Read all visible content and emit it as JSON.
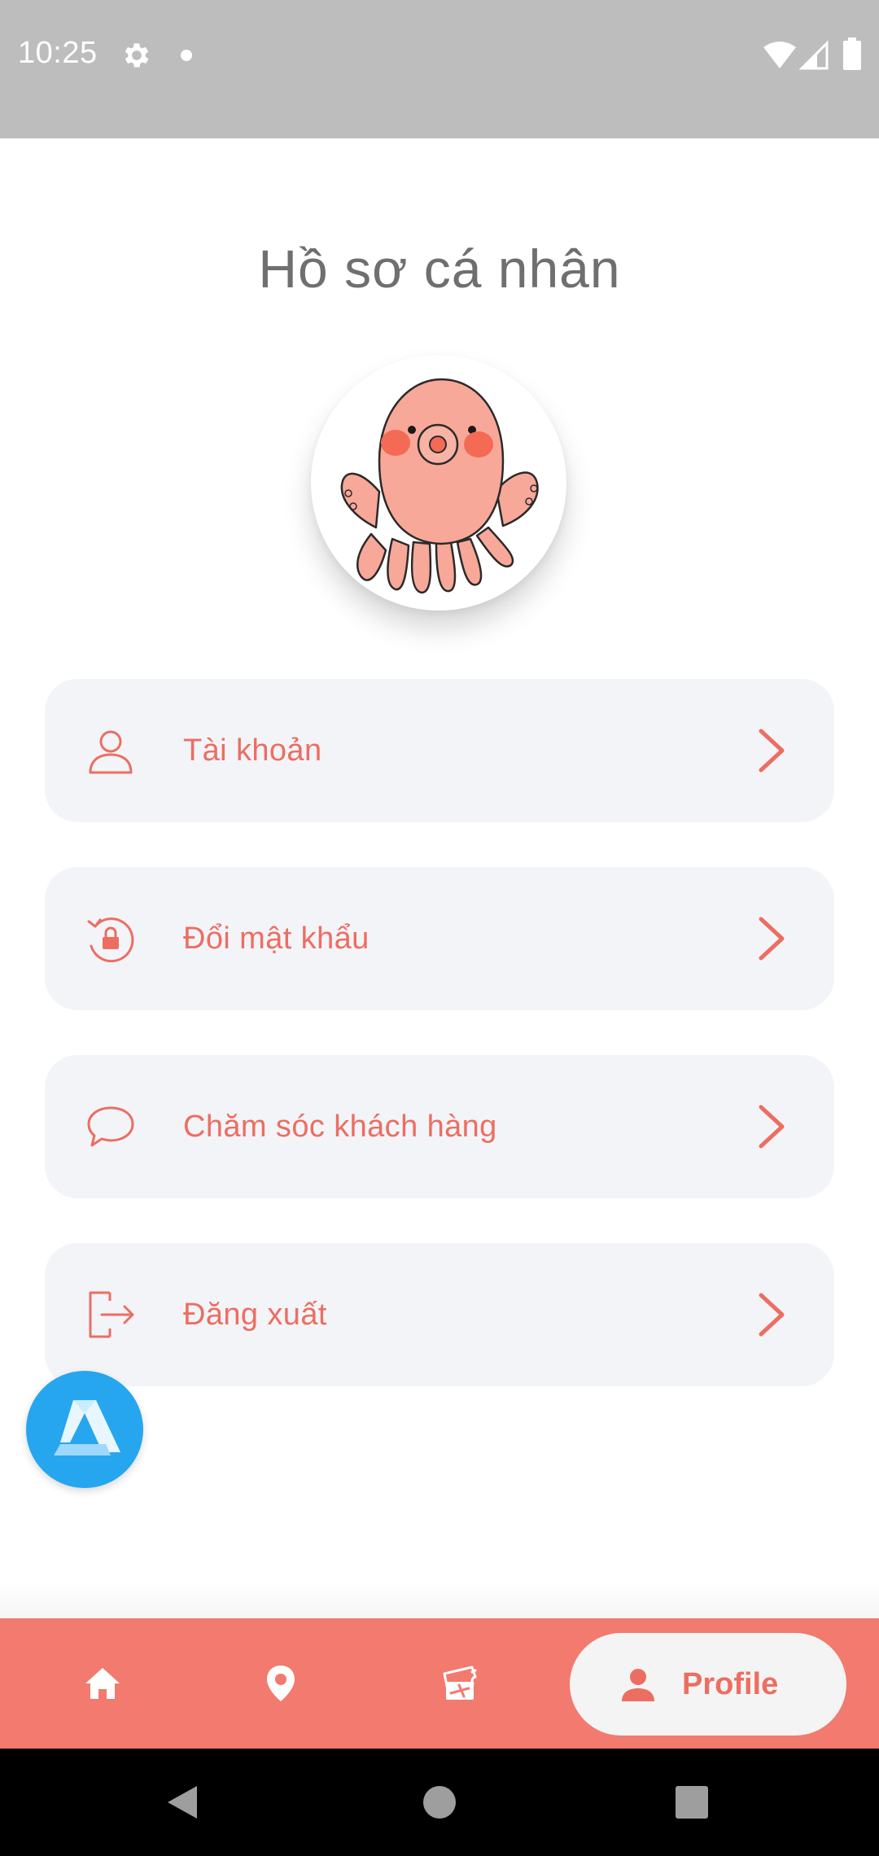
{
  "status_bar": {
    "time": "10:25",
    "icons": [
      "gear-icon",
      "dot-icon",
      "wifi-icon",
      "signal-icon",
      "battery-icon"
    ]
  },
  "page": {
    "title": "Hồ sơ cá nhân"
  },
  "avatar": {
    "icon": "octopus-avatar-icon"
  },
  "menu": {
    "items": [
      {
        "label": "Tài khoản",
        "icon": "user-icon"
      },
      {
        "label": "Đổi mật khẩu",
        "icon": "lock-rotate-icon"
      },
      {
        "label": "Chăm sóc khách hàng",
        "icon": "chat-bubble-icon"
      },
      {
        "label": "Đăng xuất",
        "icon": "logout-icon"
      }
    ]
  },
  "floating_button": {
    "icon": "app-logo-icon"
  },
  "bottom_nav": {
    "items": [
      {
        "icon": "home-icon"
      },
      {
        "icon": "location-pin-icon"
      },
      {
        "icon": "flight-ticket-icon"
      },
      {
        "icon": "person-icon",
        "label": "Profile",
        "selected": true
      }
    ]
  },
  "colors": {
    "accent": "#ec6e62",
    "nav_background": "#f27a6e",
    "menu_background": "#f3f4f8",
    "status_bar": "#bdbdbd",
    "title_text": "#6f6f6f",
    "floating_button": "#26a6ef"
  }
}
